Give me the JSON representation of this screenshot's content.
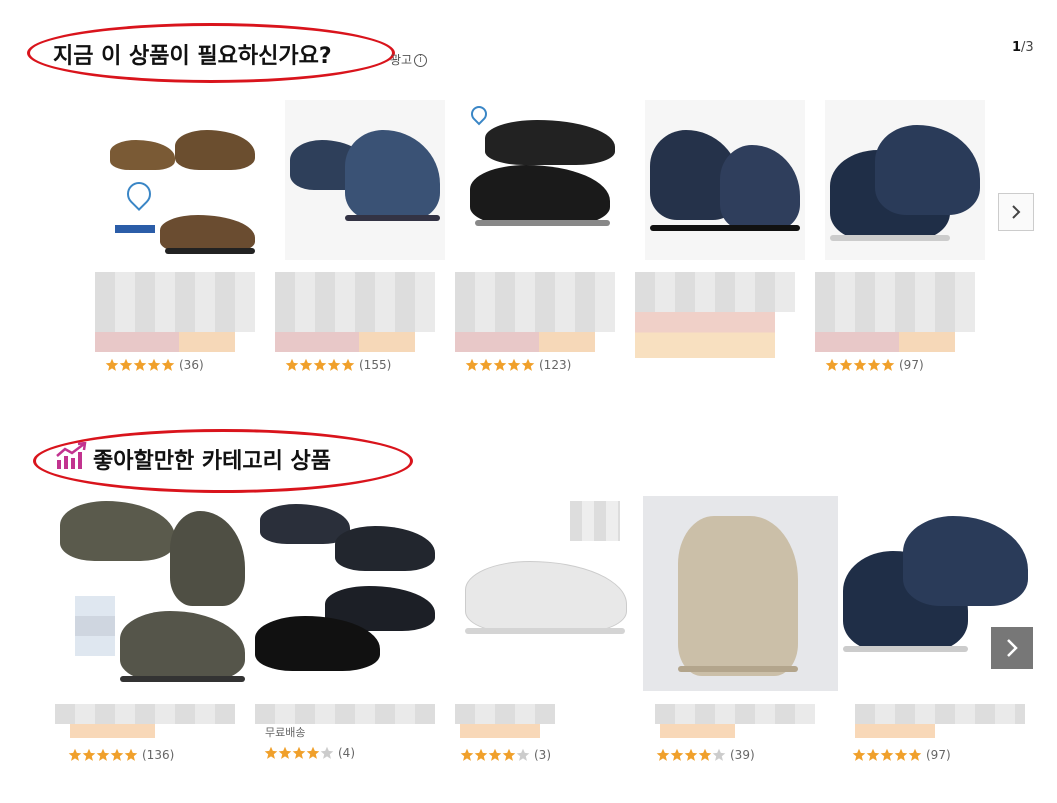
{
  "section1": {
    "title": "지금 이 상품이 필요하신가요?",
    "ad_label": "광고",
    "pager_current": "1",
    "pager_total": "/3",
    "items": [
      {
        "rating_count": "(36)"
      },
      {
        "rating_count": "(155)"
      },
      {
        "rating_count": "(123)"
      },
      {
        "rating_count": ""
      },
      {
        "rating_count": "(97)"
      }
    ]
  },
  "section2": {
    "title": "좋아할만한 카테고리 상품",
    "partial_text": "무료배송",
    "items": [
      {
        "rating_count": "(136)"
      },
      {
        "rating_count": "(4)"
      },
      {
        "rating_count": "(3)"
      },
      {
        "rating_count": "(39)"
      },
      {
        "rating_count": "(97)"
      }
    ]
  },
  "colors": {
    "accent_oval": "#d9141c",
    "star": "#f0a02b",
    "trend_icon": "#c2338f"
  }
}
